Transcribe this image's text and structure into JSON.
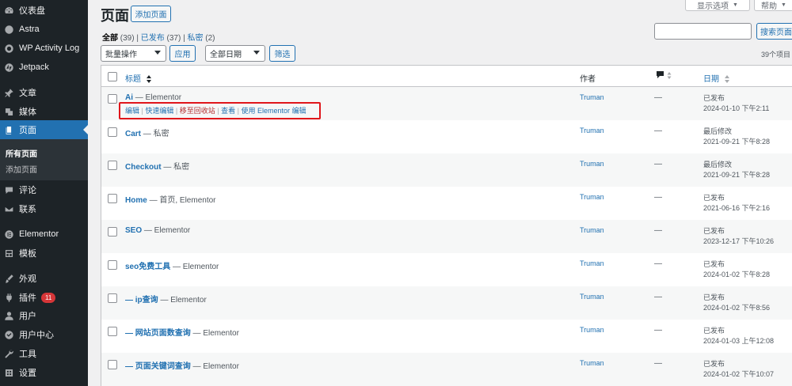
{
  "sidebar": {
    "items": [
      {
        "label": "仪表盘",
        "icon": "dashboard-icon"
      },
      {
        "label": "Astra",
        "icon": "astra-icon"
      },
      {
        "label": "WP Activity Log",
        "icon": "activity-log-icon"
      },
      {
        "label": "Jetpack",
        "icon": "jetpack-icon"
      },
      {
        "label": "文章",
        "icon": "pin-icon"
      },
      {
        "label": "媒体",
        "icon": "media-icon"
      },
      {
        "label": "页面",
        "icon": "page-icon"
      },
      {
        "label": "评论",
        "icon": "comment-icon"
      },
      {
        "label": "联系",
        "icon": "mail-icon"
      },
      {
        "label": "Elementor",
        "icon": "elementor-icon"
      },
      {
        "label": "模板",
        "icon": "template-icon"
      },
      {
        "label": "外观",
        "icon": "brush-icon"
      },
      {
        "label": "插件",
        "icon": "plugin-icon",
        "badge": "11"
      },
      {
        "label": "用户",
        "icon": "user-icon"
      },
      {
        "label": "用户中心",
        "icon": "user-center-icon"
      },
      {
        "label": "工具",
        "icon": "wrench-icon"
      },
      {
        "label": "设置",
        "icon": "settings-icon"
      }
    ],
    "submenu": {
      "all_pages": "所有页面",
      "add_page": "添加页面"
    }
  },
  "header": {
    "title": "页面",
    "add_new": "添加页面",
    "screen_options": "显示选项",
    "help": "帮助"
  },
  "filters": {
    "all": "全部",
    "all_count": "(39)",
    "published": "已发布",
    "published_count": "(37)",
    "private": "私密",
    "private_count": "(2)",
    "sep": "|"
  },
  "toolbar": {
    "bulk_actions": "批量操作",
    "apply": "应用",
    "all_dates": "全部日期",
    "filter": "筛选",
    "search_button": "搜索页面",
    "items_count": "39个项目"
  },
  "table": {
    "columns": {
      "title": "标题",
      "author": "作者",
      "date": "日期"
    },
    "row_actions": {
      "edit": "编辑",
      "quick_edit": "快速编辑",
      "trash": "移至回收站",
      "view": "查看",
      "elementor_edit": "使用 Elementor 编辑",
      "sep": " | "
    },
    "rows": [
      {
        "title": "Ai",
        "state": " — Elementor",
        "author": "Truman",
        "comments": "—",
        "status": "已发布",
        "date": "2024-01-10 下午2:11"
      },
      {
        "title": "Cart",
        "state": " — 私密",
        "author": "Truman",
        "comments": "—",
        "status": "最后修改",
        "date": "2021-09-21 下午8:28"
      },
      {
        "title": "Checkout",
        "state": " — 私密",
        "author": "Truman",
        "comments": "—",
        "status": "最后修改",
        "date": "2021-09-21 下午8:28"
      },
      {
        "title": "Home",
        "state": " — 首页, Elementor",
        "author": "Truman",
        "comments": "—",
        "status": "已发布",
        "date": "2021-06-16 下午2:16"
      },
      {
        "title": "SEO",
        "state": " — Elementor",
        "author": "Truman",
        "comments": "—",
        "status": "已发布",
        "date": "2023-12-17 下午10:26"
      },
      {
        "title": "seo免费工具",
        "state": " — Elementor",
        "author": "Truman",
        "comments": "—",
        "status": "已发布",
        "date": "2024-01-02 下午8:28"
      },
      {
        "title": "— ip查询",
        "state": " — Elementor",
        "author": "Truman",
        "comments": "—",
        "status": "已发布",
        "date": "2024-01-02 下午8:56"
      },
      {
        "title": "— 网站页面数查询",
        "state": " — Elementor",
        "author": "Truman",
        "comments": "—",
        "status": "已发布",
        "date": "2024-01-03 上午12:08"
      },
      {
        "title": "— 页面关键词查询",
        "state": " — Elementor",
        "author": "Truman",
        "comments": "—",
        "status": "已发布",
        "date": "2024-01-02 下午10:07"
      }
    ]
  },
  "colors": {
    "sidebar_bg": "#1d2327",
    "accent": "#2271b1",
    "highlight": "#e0161b"
  }
}
